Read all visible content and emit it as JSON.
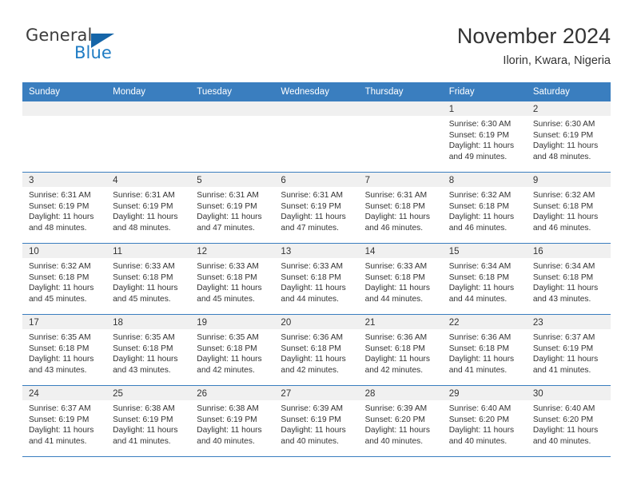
{
  "brand": {
    "word1": "General",
    "word2": "Blue",
    "logo_icon": "triangle-logo-icon",
    "accent_color": "#1f7cc4"
  },
  "header": {
    "title": "November 2024",
    "location": "Ilorin, Kwara, Nigeria"
  },
  "calendar": {
    "header_color": "#3a7ebf",
    "weekdays": [
      "Sunday",
      "Monday",
      "Tuesday",
      "Wednesday",
      "Thursday",
      "Friday",
      "Saturday"
    ],
    "weeks": [
      [
        {
          "day": "",
          "lines": []
        },
        {
          "day": "",
          "lines": []
        },
        {
          "day": "",
          "lines": []
        },
        {
          "day": "",
          "lines": []
        },
        {
          "day": "",
          "lines": []
        },
        {
          "day": "1",
          "lines": [
            "Sunrise: 6:30 AM",
            "Sunset: 6:19 PM",
            "Daylight: 11 hours",
            "and 49 minutes."
          ]
        },
        {
          "day": "2",
          "lines": [
            "Sunrise: 6:30 AM",
            "Sunset: 6:19 PM",
            "Daylight: 11 hours",
            "and 48 minutes."
          ]
        }
      ],
      [
        {
          "day": "3",
          "lines": [
            "Sunrise: 6:31 AM",
            "Sunset: 6:19 PM",
            "Daylight: 11 hours",
            "and 48 minutes."
          ]
        },
        {
          "day": "4",
          "lines": [
            "Sunrise: 6:31 AM",
            "Sunset: 6:19 PM",
            "Daylight: 11 hours",
            "and 48 minutes."
          ]
        },
        {
          "day": "5",
          "lines": [
            "Sunrise: 6:31 AM",
            "Sunset: 6:19 PM",
            "Daylight: 11 hours",
            "and 47 minutes."
          ]
        },
        {
          "day": "6",
          "lines": [
            "Sunrise: 6:31 AM",
            "Sunset: 6:19 PM",
            "Daylight: 11 hours",
            "and 47 minutes."
          ]
        },
        {
          "day": "7",
          "lines": [
            "Sunrise: 6:31 AM",
            "Sunset: 6:18 PM",
            "Daylight: 11 hours",
            "and 46 minutes."
          ]
        },
        {
          "day": "8",
          "lines": [
            "Sunrise: 6:32 AM",
            "Sunset: 6:18 PM",
            "Daylight: 11 hours",
            "and 46 minutes."
          ]
        },
        {
          "day": "9",
          "lines": [
            "Sunrise: 6:32 AM",
            "Sunset: 6:18 PM",
            "Daylight: 11 hours",
            "and 46 minutes."
          ]
        }
      ],
      [
        {
          "day": "10",
          "lines": [
            "Sunrise: 6:32 AM",
            "Sunset: 6:18 PM",
            "Daylight: 11 hours",
            "and 45 minutes."
          ]
        },
        {
          "day": "11",
          "lines": [
            "Sunrise: 6:33 AM",
            "Sunset: 6:18 PM",
            "Daylight: 11 hours",
            "and 45 minutes."
          ]
        },
        {
          "day": "12",
          "lines": [
            "Sunrise: 6:33 AM",
            "Sunset: 6:18 PM",
            "Daylight: 11 hours",
            "and 45 minutes."
          ]
        },
        {
          "day": "13",
          "lines": [
            "Sunrise: 6:33 AM",
            "Sunset: 6:18 PM",
            "Daylight: 11 hours",
            "and 44 minutes."
          ]
        },
        {
          "day": "14",
          "lines": [
            "Sunrise: 6:33 AM",
            "Sunset: 6:18 PM",
            "Daylight: 11 hours",
            "and 44 minutes."
          ]
        },
        {
          "day": "15",
          "lines": [
            "Sunrise: 6:34 AM",
            "Sunset: 6:18 PM",
            "Daylight: 11 hours",
            "and 44 minutes."
          ]
        },
        {
          "day": "16",
          "lines": [
            "Sunrise: 6:34 AM",
            "Sunset: 6:18 PM",
            "Daylight: 11 hours",
            "and 43 minutes."
          ]
        }
      ],
      [
        {
          "day": "17",
          "lines": [
            "Sunrise: 6:35 AM",
            "Sunset: 6:18 PM",
            "Daylight: 11 hours",
            "and 43 minutes."
          ]
        },
        {
          "day": "18",
          "lines": [
            "Sunrise: 6:35 AM",
            "Sunset: 6:18 PM",
            "Daylight: 11 hours",
            "and 43 minutes."
          ]
        },
        {
          "day": "19",
          "lines": [
            "Sunrise: 6:35 AM",
            "Sunset: 6:18 PM",
            "Daylight: 11 hours",
            "and 42 minutes."
          ]
        },
        {
          "day": "20",
          "lines": [
            "Sunrise: 6:36 AM",
            "Sunset: 6:18 PM",
            "Daylight: 11 hours",
            "and 42 minutes."
          ]
        },
        {
          "day": "21",
          "lines": [
            "Sunrise: 6:36 AM",
            "Sunset: 6:18 PM",
            "Daylight: 11 hours",
            "and 42 minutes."
          ]
        },
        {
          "day": "22",
          "lines": [
            "Sunrise: 6:36 AM",
            "Sunset: 6:18 PM",
            "Daylight: 11 hours",
            "and 41 minutes."
          ]
        },
        {
          "day": "23",
          "lines": [
            "Sunrise: 6:37 AM",
            "Sunset: 6:19 PM",
            "Daylight: 11 hours",
            "and 41 minutes."
          ]
        }
      ],
      [
        {
          "day": "24",
          "lines": [
            "Sunrise: 6:37 AM",
            "Sunset: 6:19 PM",
            "Daylight: 11 hours",
            "and 41 minutes."
          ]
        },
        {
          "day": "25",
          "lines": [
            "Sunrise: 6:38 AM",
            "Sunset: 6:19 PM",
            "Daylight: 11 hours",
            "and 41 minutes."
          ]
        },
        {
          "day": "26",
          "lines": [
            "Sunrise: 6:38 AM",
            "Sunset: 6:19 PM",
            "Daylight: 11 hours",
            "and 40 minutes."
          ]
        },
        {
          "day": "27",
          "lines": [
            "Sunrise: 6:39 AM",
            "Sunset: 6:19 PM",
            "Daylight: 11 hours",
            "and 40 minutes."
          ]
        },
        {
          "day": "28",
          "lines": [
            "Sunrise: 6:39 AM",
            "Sunset: 6:20 PM",
            "Daylight: 11 hours",
            "and 40 minutes."
          ]
        },
        {
          "day": "29",
          "lines": [
            "Sunrise: 6:40 AM",
            "Sunset: 6:20 PM",
            "Daylight: 11 hours",
            "and 40 minutes."
          ]
        },
        {
          "day": "30",
          "lines": [
            "Sunrise: 6:40 AM",
            "Sunset: 6:20 PM",
            "Daylight: 11 hours",
            "and 40 minutes."
          ]
        }
      ]
    ]
  }
}
